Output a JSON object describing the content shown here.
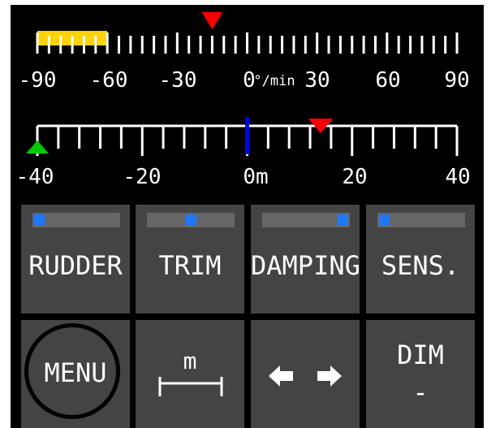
{
  "rate_scale": {
    "labels": [
      "-90",
      "-60",
      "-30",
      "0",
      "30",
      "60",
      "90"
    ],
    "unit": "°/min",
    "min": -90,
    "max": 90,
    "rate_of_turn_value": -15,
    "highlight_range": [
      -90,
      -60
    ],
    "highlight_color": "#ffd200",
    "marker_color": "#ff0000"
  },
  "distance_scale": {
    "labels": [
      "-40",
      "-20",
      "0m",
      "20",
      "40"
    ],
    "min": -40,
    "max": 40,
    "center_value": 0,
    "red_marker_value": 14,
    "green_marker_value": -40,
    "center_color": "#0000ff",
    "red_marker_color": "#ff0000",
    "green_marker_color": "#00cc00"
  },
  "buttons_row1": [
    {
      "label": "RUDDER",
      "level": 0
    },
    {
      "label": "TRIM",
      "level": 0.5
    },
    {
      "label": "DAMPING",
      "level": 1
    },
    {
      "label": "SENS.",
      "level": 0
    }
  ],
  "buttons_row2": {
    "menu": "MENU",
    "unit_label": "m",
    "dim": "DIM",
    "dim_value": "-"
  },
  "colors": {
    "background": "#000000",
    "button": "#444444",
    "slider_track": "#666666",
    "slider_knob": "#1e78ff"
  }
}
